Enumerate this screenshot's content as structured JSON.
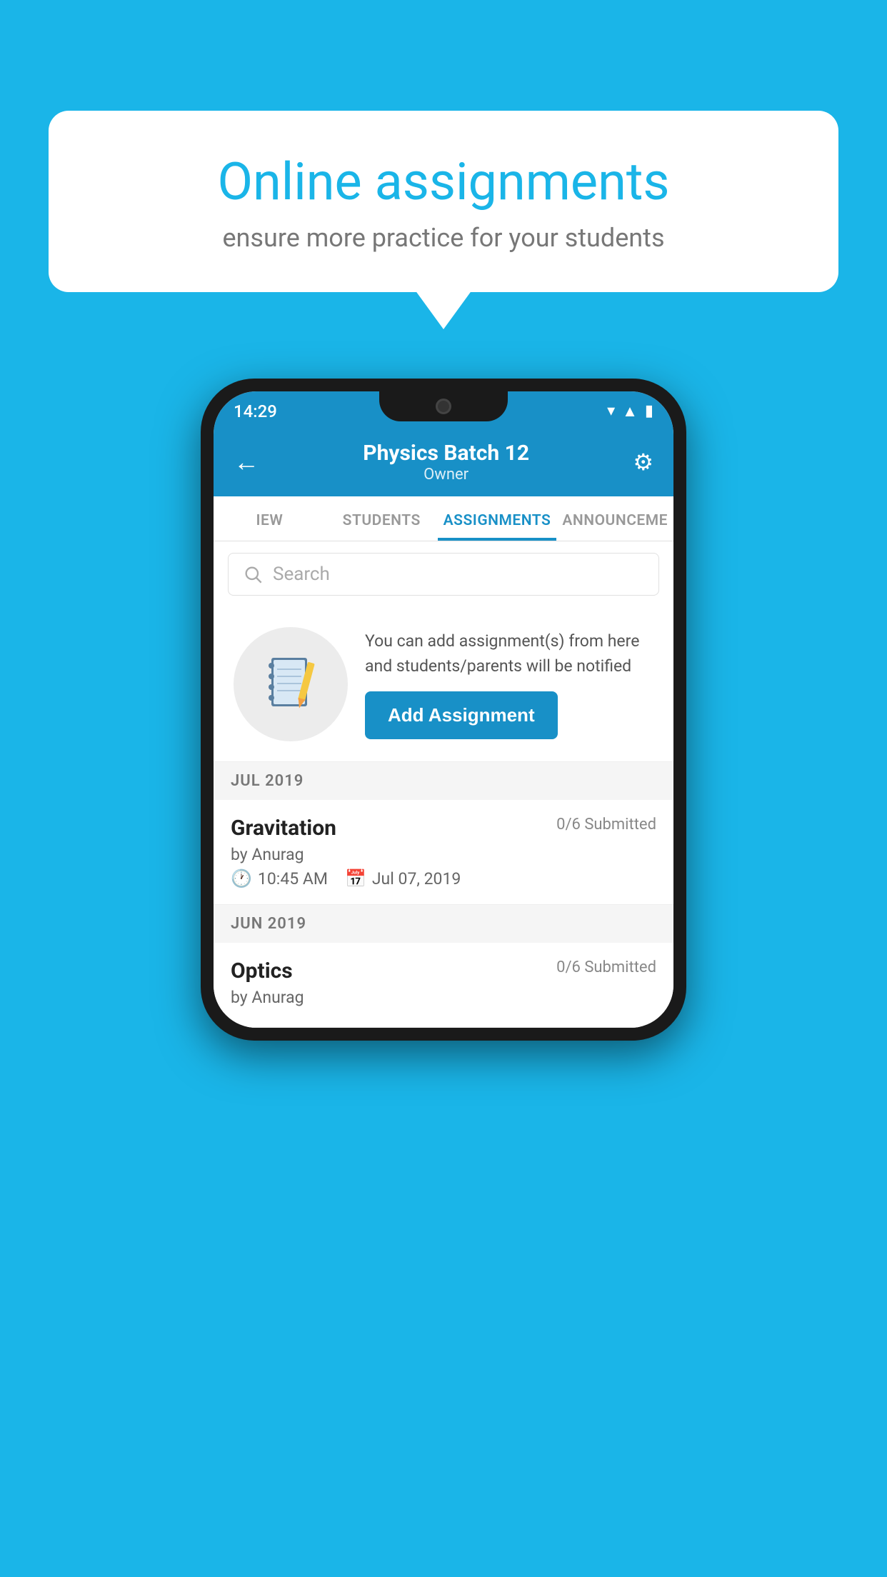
{
  "background_color": "#1ab5e8",
  "speech_bubble": {
    "title": "Online assignments",
    "subtitle": "ensure more practice for your students"
  },
  "phone": {
    "status_bar": {
      "time": "14:29",
      "icons": [
        "wifi",
        "signal",
        "battery"
      ]
    },
    "header": {
      "title": "Physics Batch 12",
      "subtitle": "Owner",
      "back_label": "←",
      "settings_label": "⚙"
    },
    "tabs": [
      {
        "label": "IEW",
        "active": false
      },
      {
        "label": "STUDENTS",
        "active": false
      },
      {
        "label": "ASSIGNMENTS",
        "active": true
      },
      {
        "label": "ANNOUNCEME",
        "active": false
      }
    ],
    "search": {
      "placeholder": "Search"
    },
    "promo": {
      "description": "You can add assignment(s) from here and students/parents will be notified",
      "button_label": "Add Assignment"
    },
    "month_sections": [
      {
        "label": "JUL 2019",
        "assignments": [
          {
            "name": "Gravitation",
            "submitted": "0/6 Submitted",
            "by": "by Anurag",
            "time": "10:45 AM",
            "date": "Jul 07, 2019"
          }
        ]
      },
      {
        "label": "JUN 2019",
        "assignments": [
          {
            "name": "Optics",
            "submitted": "0/6 Submitted",
            "by": "by Anurag",
            "time": "",
            "date": ""
          }
        ]
      }
    ]
  }
}
